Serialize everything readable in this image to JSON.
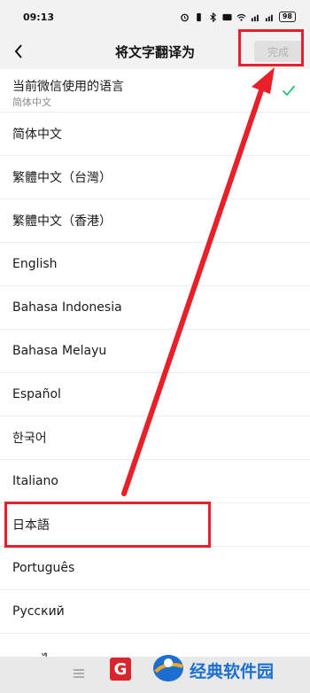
{
  "status_bar": {
    "time": "09:13",
    "battery": "98"
  },
  "header": {
    "back_icon": "chevron-left-icon",
    "title": "将文字翻译为",
    "done_label": "完成"
  },
  "current_language": {
    "label": "当前微信使用的语言",
    "value": "简体中文",
    "selected": true
  },
  "languages": [
    {
      "label": "简体中文"
    },
    {
      "label": "繁體中文（台灣）"
    },
    {
      "label": "繁體中文（香港）"
    },
    {
      "label": "English"
    },
    {
      "label": "Bahasa Indonesia"
    },
    {
      "label": "Bahasa Melayu"
    },
    {
      "label": "Español"
    },
    {
      "label": "한국어"
    },
    {
      "label": "Italiano"
    },
    {
      "label": "日本語"
    },
    {
      "label": "Português"
    },
    {
      "label": "Русский"
    },
    {
      "label": "ภาษาไทย"
    }
  ],
  "colors": {
    "highlight": "#e8202a",
    "check": "#07c160",
    "watermark_text": "#1c6fd1"
  },
  "watermark": {
    "badge": "G",
    "text": "经典软件园"
  }
}
